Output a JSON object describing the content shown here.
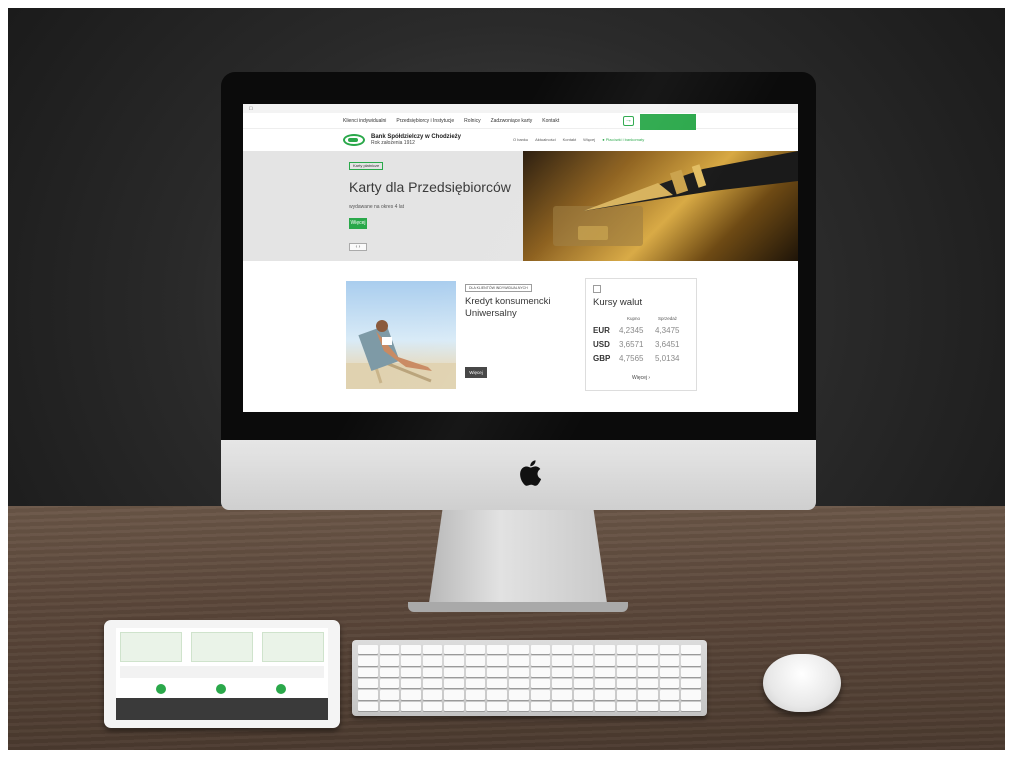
{
  "colors": {
    "brand_green": "#2aa84a",
    "dark_button": "#3f3f3f"
  },
  "macos_menubar": {
    "app_name": "",
    "menus": [
      "",
      "",
      "",
      "",
      "",
      "",
      "",
      "",
      ""
    ],
    "status": ""
  },
  "top_nav": {
    "items": [
      "Klienci indywidualni",
      "Przedsiębiorcy i Instytucje",
      "Rolnicy",
      "Zadzwoniące karty",
      "Kontakt"
    ],
    "login_icon": "login-arrow-icon",
    "ebanking_label": ""
  },
  "header": {
    "bank_name": "Bank Spółdzielczy w Chodzieży",
    "founded": "Rok założenia 1912",
    "nav": [
      "O banku",
      "Aktualności",
      "Kontakt",
      "Więcej"
    ],
    "branches_label": "Placówki i bankomaty"
  },
  "hero": {
    "tag": "Karty płatnicze",
    "title": "Karty dla Przedsiębiorców",
    "subtitle": "wydawane na okres 4 lat",
    "button": "Więcej",
    "slider_arrows": "‹ ›"
  },
  "loan_card": {
    "tag": "DLA KLIENTÓW INDYWIDUALNYCH",
    "title": "Kredyt konsumencki Uniwersalny",
    "description": "",
    "button": "Więcej"
  },
  "exchange": {
    "tag": "",
    "title": "Kursy walut",
    "col_buy": "Kupno",
    "col_sell": "Sprzedaż",
    "rows": [
      {
        "currency": "EUR",
        "buy": "4,2345",
        "sell": "4,3475"
      },
      {
        "currency": "USD",
        "buy": "3,6571",
        "sell": "3,6451"
      },
      {
        "currency": "GBP",
        "buy": "4,7565",
        "sell": "5,0134"
      }
    ],
    "more": "Więcej ›"
  }
}
